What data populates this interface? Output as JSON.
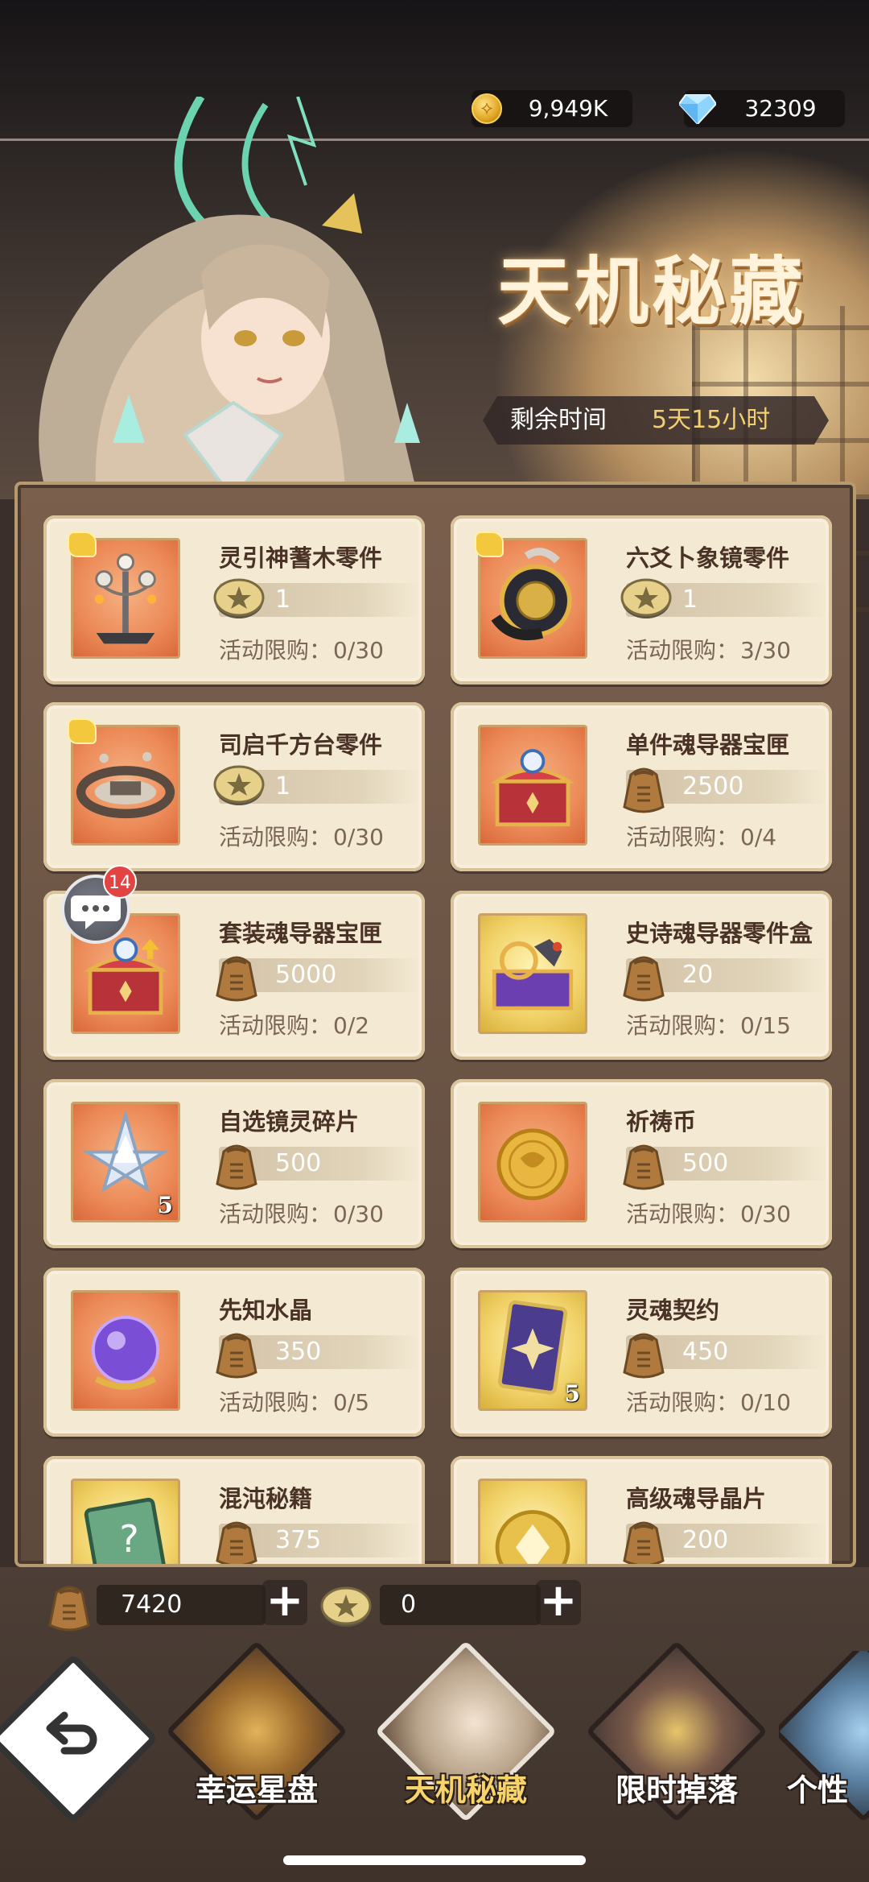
{
  "header": {
    "gold_amount": "9,949K",
    "diamond_amount": "32309",
    "title": "天机秘藏",
    "timer_label": "剩余时间",
    "timer_value": "5天15小时"
  },
  "shop": {
    "limit_label": "活动限购：",
    "items": [
      {
        "name": "灵引神蓍木零件",
        "price": "1",
        "currency": "star-coin",
        "limit": "0/30",
        "bg": "orange",
        "puzzle": true,
        "qty": ""
      },
      {
        "name": "六爻卜象镜零件",
        "price": "1",
        "currency": "star-coin",
        "limit": "3/30",
        "bg": "orange",
        "puzzle": true,
        "qty": ""
      },
      {
        "name": "司启千方台零件",
        "price": "1",
        "currency": "star-coin",
        "limit": "0/30",
        "bg": "orange",
        "puzzle": true,
        "qty": ""
      },
      {
        "name": "单件魂导器宝匣",
        "price": "2500",
        "currency": "token-bag",
        "limit": "0/4",
        "bg": "orange",
        "puzzle": false,
        "qty": ""
      },
      {
        "name": "套装魂导器宝匣",
        "price": "5000",
        "currency": "token-bag",
        "limit": "0/2",
        "bg": "orange",
        "puzzle": false,
        "qty": ""
      },
      {
        "name": "史诗魂导器零件盒",
        "price": "20",
        "currency": "token-bag",
        "limit": "0/15",
        "bg": "gold",
        "puzzle": false,
        "qty": ""
      },
      {
        "name": "自选镜灵碎片",
        "price": "500",
        "currency": "token-bag",
        "limit": "0/30",
        "bg": "orange",
        "puzzle": false,
        "qty": "5"
      },
      {
        "name": "祈祷币",
        "price": "500",
        "currency": "token-bag",
        "limit": "0/30",
        "bg": "orange",
        "puzzle": false,
        "qty": ""
      },
      {
        "name": "先知水晶",
        "price": "350",
        "currency": "token-bag",
        "limit": "0/5",
        "bg": "orange",
        "puzzle": false,
        "qty": ""
      },
      {
        "name": "灵魂契约",
        "price": "450",
        "currency": "token-bag",
        "limit": "0/10",
        "bg": "gold",
        "puzzle": false,
        "qty": "5"
      },
      {
        "name": "混沌秘籍",
        "price": "375",
        "currency": "token-bag",
        "limit": "",
        "bg": "gold",
        "puzzle": false,
        "qty": ""
      },
      {
        "name": "高级魂导晶片",
        "price": "200",
        "currency": "token-bag",
        "limit": "",
        "bg": "gold",
        "puzzle": false,
        "qty": ""
      }
    ]
  },
  "chat": {
    "badge_count": "14"
  },
  "resources": {
    "token_bag_amount": "7420",
    "star_coin_amount": "0"
  },
  "nav": {
    "items": [
      {
        "label": "幸运星盘"
      },
      {
        "label": "天机秘藏"
      },
      {
        "label": "限时掉落"
      },
      {
        "label": "个性"
      }
    ]
  },
  "colors": {
    "accent_gold": "#f6d36b",
    "card_bg": "#f4ead3",
    "text_brown": "#4a3326"
  }
}
